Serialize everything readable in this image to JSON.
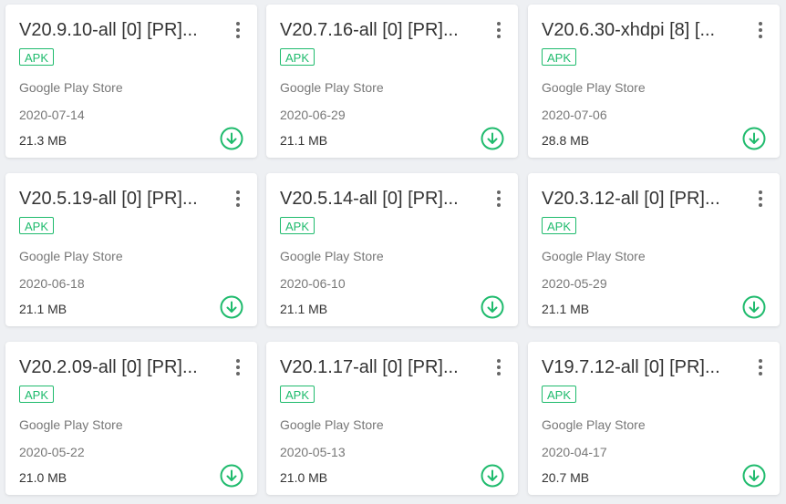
{
  "colors": {
    "accent": "#1fbb6d",
    "title": "#333333",
    "meta": "#777777",
    "background": "#eef0f3"
  },
  "cards": [
    {
      "title": "V20.9.10-all [0] [PR]...",
      "badge": "APK",
      "source": "Google Play Store",
      "date": "2020-07-14",
      "size": "21.3 MB"
    },
    {
      "title": "V20.7.16-all [0] [PR]...",
      "badge": "APK",
      "source": "Google Play Store",
      "date": "2020-06-29",
      "size": "21.1 MB"
    },
    {
      "title": "V20.6.30-xhdpi [8] [...",
      "badge": "APK",
      "source": "Google Play Store",
      "date": "2020-07-06",
      "size": "28.8 MB"
    },
    {
      "title": "V20.5.19-all [0] [PR]...",
      "badge": "APK",
      "source": "Google Play Store",
      "date": "2020-06-18",
      "size": "21.1 MB"
    },
    {
      "title": "V20.5.14-all [0] [PR]...",
      "badge": "APK",
      "source": "Google Play Store",
      "date": "2020-06-10",
      "size": "21.1 MB"
    },
    {
      "title": "V20.3.12-all [0] [PR]...",
      "badge": "APK",
      "source": "Google Play Store",
      "date": "2020-05-29",
      "size": "21.1 MB"
    },
    {
      "title": "V20.2.09-all [0] [PR]...",
      "badge": "APK",
      "source": "Google Play Store",
      "date": "2020-05-22",
      "size": "21.0 MB"
    },
    {
      "title": "V20.1.17-all [0] [PR]...",
      "badge": "APK",
      "source": "Google Play Store",
      "date": "2020-05-13",
      "size": "21.0 MB"
    },
    {
      "title": "V19.7.12-all [0] [PR]...",
      "badge": "APK",
      "source": "Google Play Store",
      "date": "2020-04-17",
      "size": "20.7 MB"
    }
  ],
  "icons": {
    "more": "more-vertical-icon",
    "download": "download-circle-icon"
  }
}
